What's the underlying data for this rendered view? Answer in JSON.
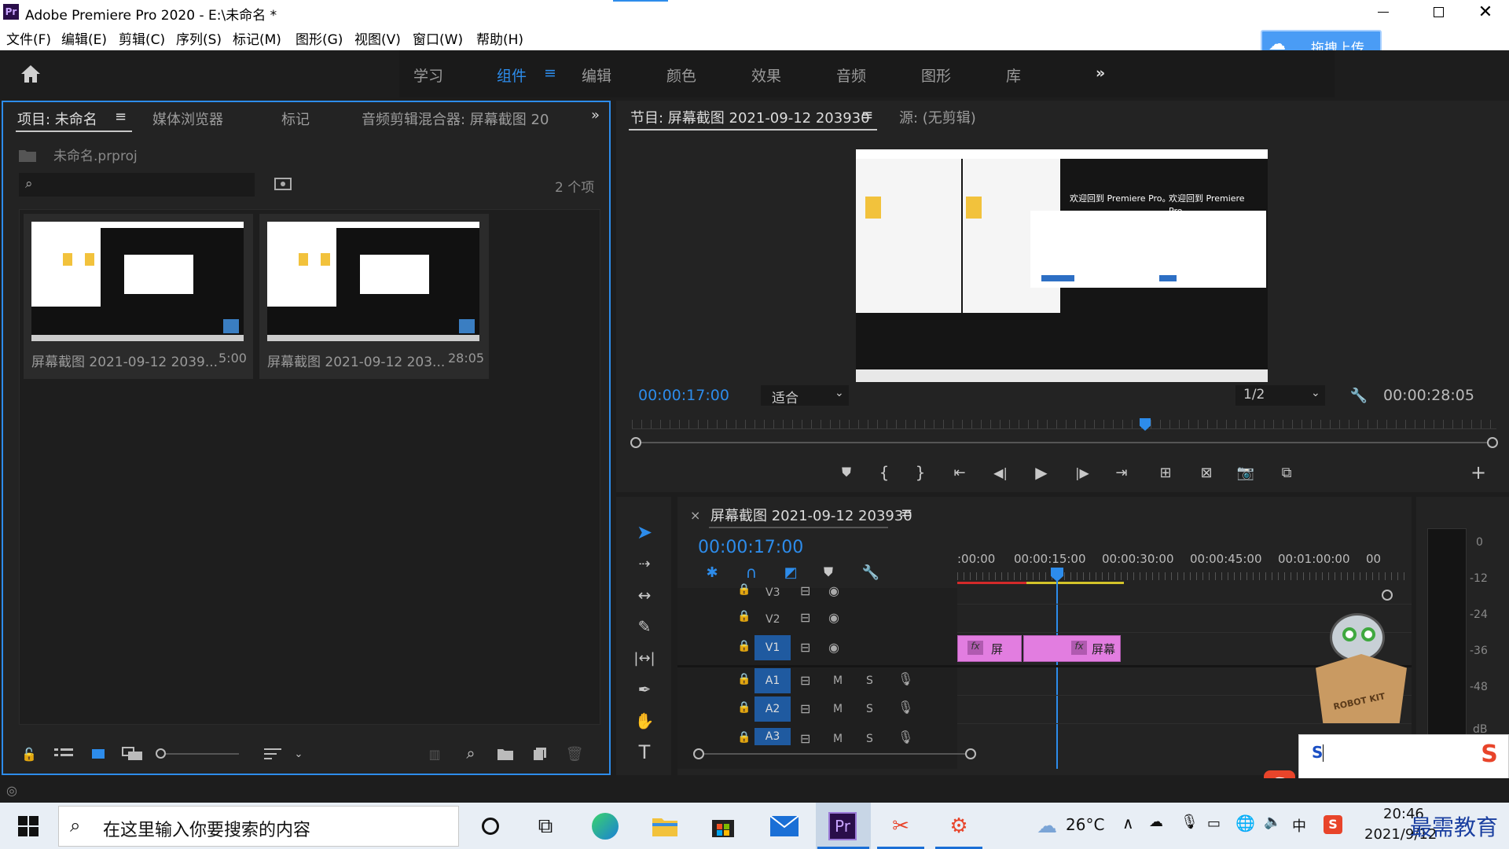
{
  "window": {
    "title": "Adobe Premiere Pro 2020 - E:\\未命名 *",
    "app_badge": "Pr"
  },
  "menu": [
    "文件(F)",
    "编辑(E)",
    "剪辑(C)",
    "序列(S)",
    "标记(M)",
    "图形(G)",
    "视图(V)",
    "窗口(W)",
    "帮助(H)"
  ],
  "upload_button": "拖拽上传",
  "workspaces": [
    "学习",
    "组件",
    "编辑",
    "颜色",
    "效果",
    "音频",
    "图形",
    "库"
  ],
  "active_workspace": "组件",
  "project_panel": {
    "tabs": [
      "项目: 未命名",
      "媒体浏览器",
      "标记",
      "音频剪辑混合器: 屏幕截图 20"
    ],
    "project_file": "未命名.prproj",
    "search_placeholder": "",
    "item_count": "2 个项",
    "items": [
      {
        "name": "屏幕截图 2021-09-12 2039...",
        "duration": "5:00"
      },
      {
        "name": "屏幕截图 2021-09-12 203...",
        "duration": "28:05"
      }
    ]
  },
  "program_monitor": {
    "tabs": [
      "节目: 屏幕截图 2021-09-12 203930",
      "源: (无剪辑)"
    ],
    "timecode": "00:00:17:00",
    "fit": "适合",
    "resolution": "1/2",
    "duration": "00:00:28:05",
    "playhead_fraction": 0.6,
    "preview_text_1": "欢迎回到 Premiere Pro。",
    "preview_text_2": "欢迎回到 Premiere Pro。"
  },
  "timeline": {
    "title": "屏幕截图 2021-09-12 203930",
    "timecode": "00:00:17:00",
    "ruler": [
      ":00:00",
      "00:00:15:00",
      "00:00:30:00",
      "00:00:45:00",
      "00:01:00:00",
      "00"
    ],
    "video_tracks": [
      "V3",
      "V2",
      "V1"
    ],
    "audio_tracks": [
      "A1",
      "A2",
      "A3"
    ],
    "track_m": "M",
    "track_s": "S",
    "clips": [
      {
        "label": "屏",
        "fx": "fx"
      },
      {
        "label": "屏幕",
        "fx": "fx"
      }
    ],
    "meter_labels": [
      "0",
      "-12",
      "-24",
      "-36",
      "-48",
      "dB"
    ]
  },
  "ime": {
    "text": "S"
  },
  "taskbar": {
    "search_placeholder": "在这里输入你要搜索的内容",
    "temperature": "26°C",
    "time": "20:46",
    "date": "2021/9/12",
    "lang": "中",
    "watermark": "最需教育"
  },
  "colors": {
    "accent": "#2d8ceb",
    "clip": "#e27de0",
    "clip_dark": "#b05ab0",
    "track_active": "#1f5aa0"
  }
}
